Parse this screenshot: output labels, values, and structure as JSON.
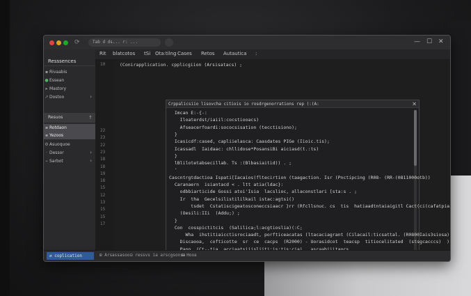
{
  "window": {
    "address": "Tab d ds... r: ...",
    "controls": {
      "minimize": "—",
      "maximize": "☐",
      "close": "✕"
    }
  },
  "menu": [
    "Rit",
    "blatcotos",
    "tSi",
    "Ota:tilng",
    "Cases",
    "Retos",
    "Autautica",
    ":"
  ],
  "sidebar": {
    "title": "Resssences",
    "items_top": [
      {
        "label": "Rivaabis",
        "icon": "layers-icon"
      },
      {
        "label": "Essean",
        "icon": "leaf-icon"
      },
      {
        "label": "Mastory",
        "icon": "history-icon"
      },
      {
        "label": "Dostoo",
        "icon": "arrow-icon"
      }
    ],
    "section": "Resuos",
    "items_bottom": [
      {
        "label": "Rotdaon",
        "icon": "file-icon"
      },
      {
        "label": "Yezoos",
        "icon": "leaf-icon"
      },
      {
        "label": "Asuoquoe",
        "icon": "gear-icon"
      },
      {
        "label": "Dessor",
        "icon": "box-icon"
      },
      {
        "label": "Sarbot",
        "icon": "plug-icon"
      }
    ]
  },
  "editor": {
    "top_line_number": "10",
    "top_code": "(Conirapplication. cpplicgiion (Arsisatacs) ;",
    "panel_title": "Crppalicsiio lisovcha citiois io rosdrgenorrations rep (:(A:",
    "lines": [
      {
        "n": "",
        "text": "  Imcan E:-{-:"
      },
      {
        "n": "",
        "text": "    Iloaterdst/iaiil:cocstiooacs)"
      },
      {
        "n": "22",
        "text": "    Afseacerfoardi:sococsisation (tecctisiono);"
      },
      {
        "n": "22",
        "text": "  }"
      },
      {
        "n": "",
        "text": "  Icasicdf:cased, capliielasca: Caasdates PIGe (Iioic.tis);"
      },
      {
        "n": "",
        "text": "  Icassadl  Iaidaac: chllidose*PosansiBi aiciasd(t.:ts)"
      },
      {
        "n": "",
        "text": "  }"
      },
      {
        "n": "",
        "text": "  lBlilotetabsecillab. Ts :(Blbasiaitid)) . ;"
      },
      {
        "n": "",
        "text": "  '"
      },
      {
        "n": "22",
        "text": "Cascntrgtdactioa Ispati[Iacaios(fltecirtion (taagaction. Isr (Pnctipcing (R08- (RR-(0811000otb))"
      },
      {
        "n": "22",
        "text": "  Caranaern  isiantacd < . ltt atia(ldac}:"
      },
      {
        "n": "",
        "text": "    odbbiarticide Gossi atoi'Isia  lacslioc, allaconstlari [sta:s . ;"
      },
      {
        "n": "",
        "text": "    Ir  tha  Gecelsilistililkail istac:agtsi()"
      },
      {
        "n": "",
        "text": "        tsdet  Cstatiscigeatosconeccsiaacr }rr (Rfcllsnuc. cs  tis  hatiaadtntaiaigitl Cact(ci(cafatpiaigs)"
      },
      {
        "n": "",
        "text": "    (Oesili:IIi  (Addu;) ;"
      },
      {
        "n": "",
        "text": "  }"
      },
      {
        "n": "",
        "text": "  Con  cosspictitcis  (Salilica;l:acgtioslia)(:C;"
      },
      {
        "n": "",
        "text": "      Wha  ihstitiaicctisrociaadt, porfticeacatas (ltacaciagrant (Cilacail:ticsattal. (R0800Iais3siosa)) ;"
      },
      {
        "n": "",
        "text": "    Discaooa,  cofticotte  sr  ce  cacps  (R2000) - Uorasidcot  teacsp  titiocelitated  (stsgcacccs)  ) ;"
      },
      {
        "n": "",
        "text": "    Paon. (Ct--tia  acciaatsiiisliiti:is:tis:ciai.  ascaabiiitaocs ,"
      },
      {
        "n": "",
        "text": "          atlitcaditiascd  [(Idilcoartitgoastidacs ,"
      },
      {
        "n": "",
        "text": "      Lttoicaucccsiiiaiti (Gocilicaisiiaioa:ic:) ;"
      },
      {
        "n": "",
        "text": "  }"
      },
      {
        "n": "",
        "text": "  *"
      }
    ],
    "line_numbers": [
      "22",
      "23",
      "22",
      "23",
      "18",
      "18",
      "19",
      "18",
      "15",
      "12",
      "13",
      "15",
      "15",
      "17"
    ]
  },
  "status": {
    "branch": "⇄ coplication",
    "items": [
      "⊞ Arsassasoo",
      "⊟ ressvs  ia  arscgsonsa",
      "⊞ Hooa"
    ]
  }
}
